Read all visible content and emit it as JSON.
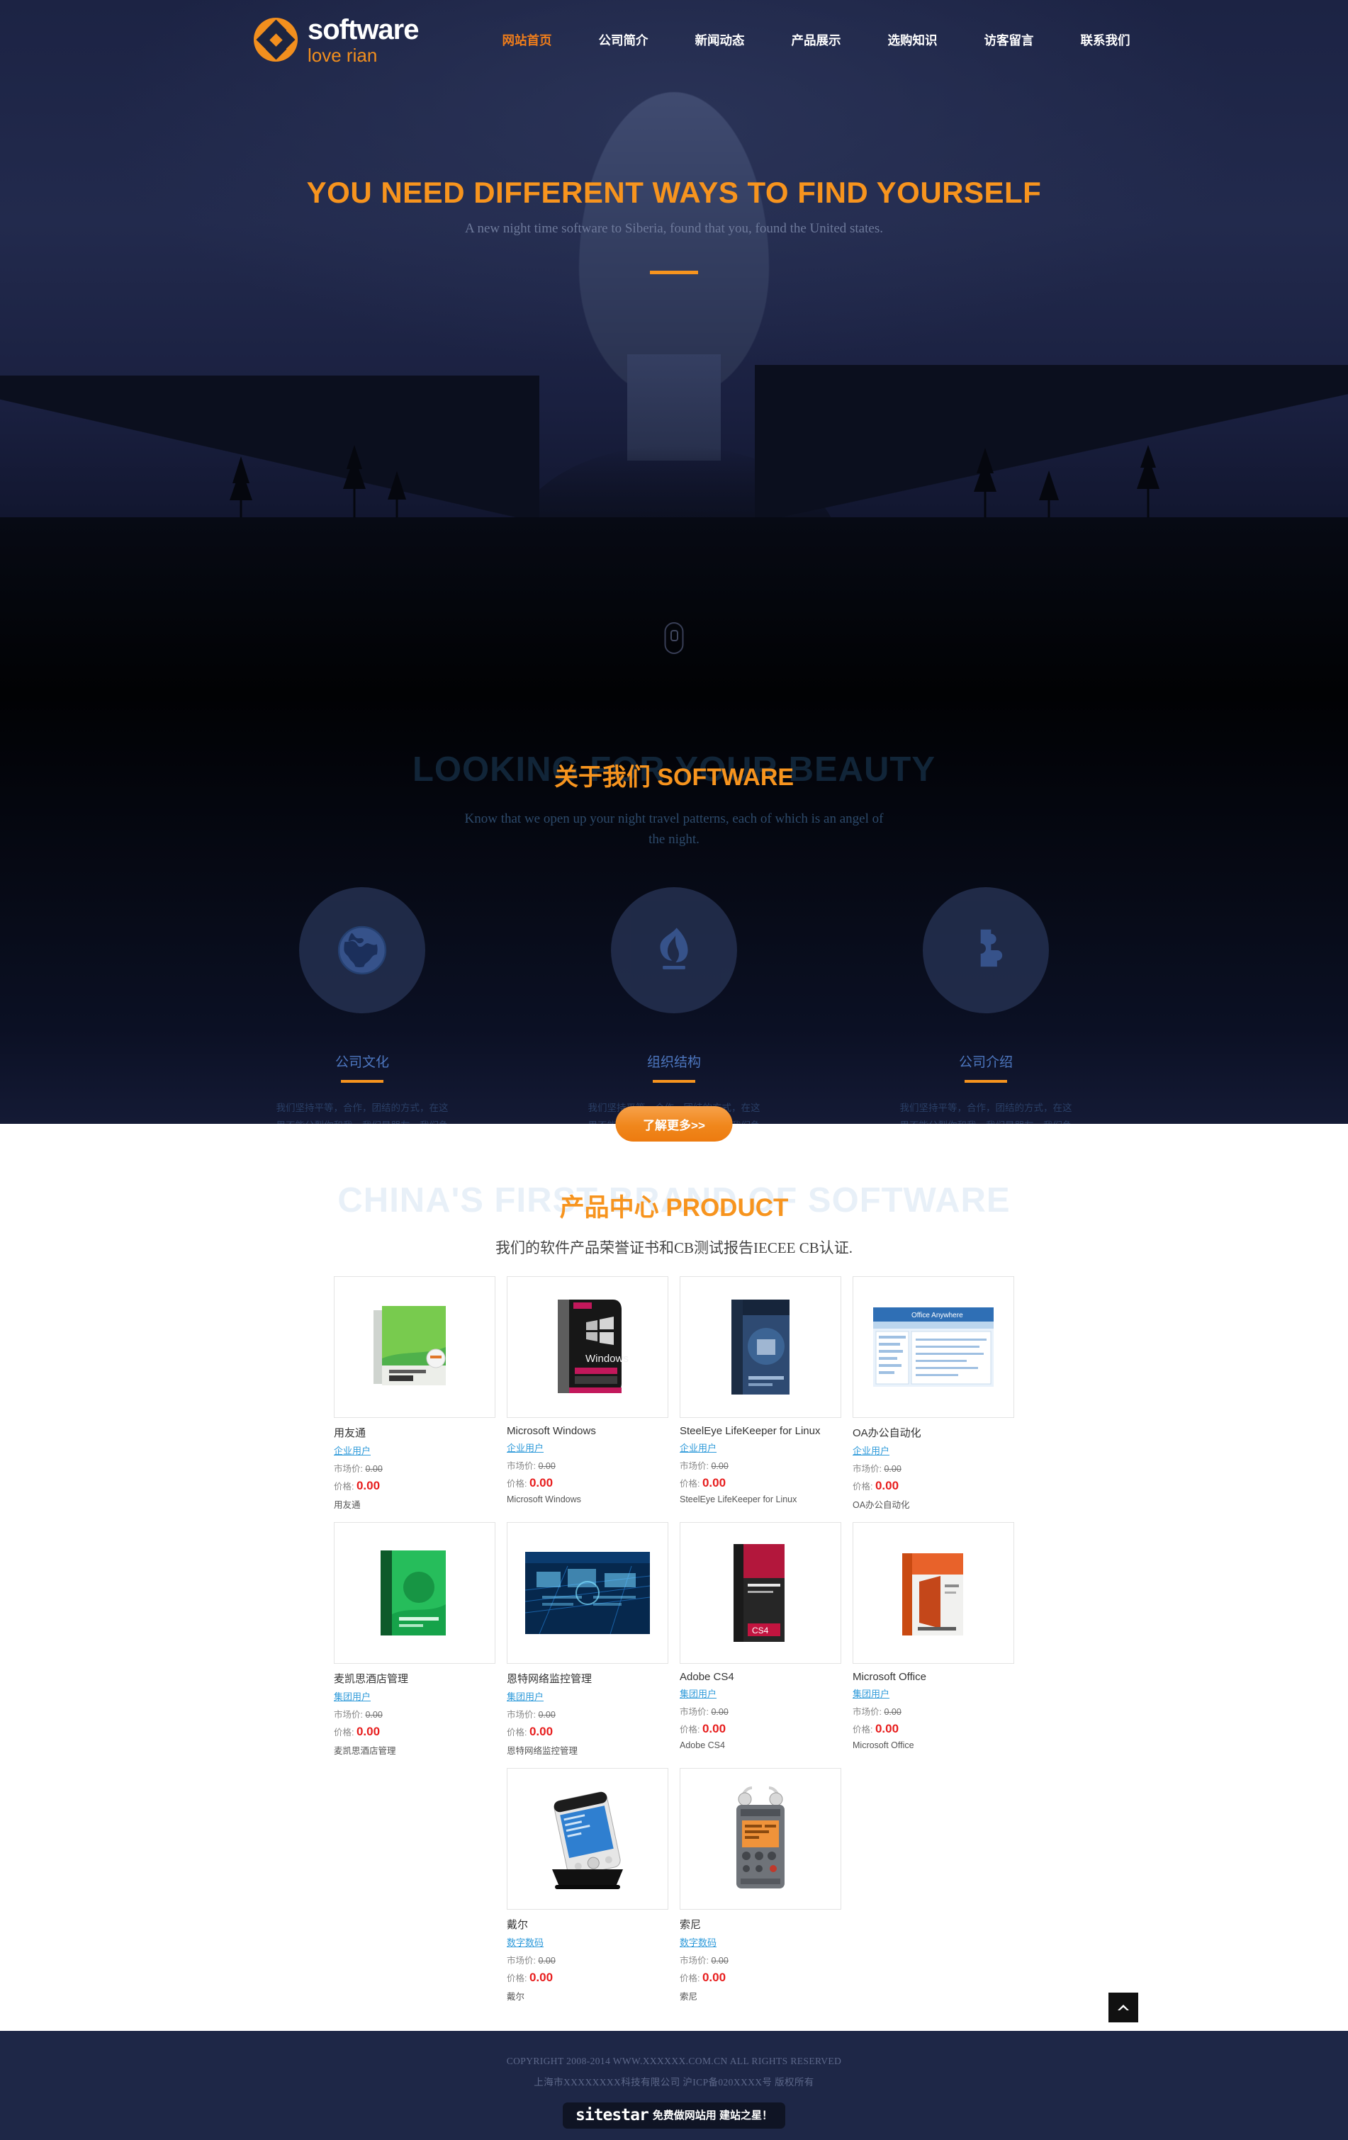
{
  "brand": {
    "title": "software",
    "subtitle": "love rian",
    "logo_icon": "diamond-cross-logo"
  },
  "nav": {
    "items": [
      {
        "label": "网站首页",
        "active": true
      },
      {
        "label": "公司简介",
        "active": false
      },
      {
        "label": "新闻动态",
        "active": false
      },
      {
        "label": "产品展示",
        "active": false
      },
      {
        "label": "选购知识",
        "active": false
      },
      {
        "label": "访客留言",
        "active": false
      },
      {
        "label": "联系我们",
        "active": false
      }
    ]
  },
  "hero": {
    "title": "YOU NEED DIFFERENT WAYS TO FIND YOURSELF",
    "subtitle": "A new night time software to Siberia, found that you, found the United states.",
    "scroll_icon": "mouse-scroll-icon"
  },
  "about": {
    "watermark": "LOOKING FOR YOUR BEAUTY",
    "title": "关于我们 SOFTWARE",
    "description": "Know that we open up your night travel patterns, each of which is an angel of the night.",
    "cards": [
      {
        "icon": "globe-icon",
        "title": "公司文化",
        "text": "我们坚持平等，合作，团结的方式，在这里不能分裂你和我，我们是朋友，我们争取一个共同的目标。"
      },
      {
        "icon": "flame-icon",
        "title": "组织结构",
        "text": "我们坚持平等，合作，团结的方式，在这里不能分裂你和我，我们是朋友，我们争取一个共同的目标。"
      },
      {
        "icon": "puzzle-icon",
        "title": "公司介绍",
        "text": "我们坚持平等，合作，团结的方式，在这里不能分裂你和我，我们是朋友，我们争取一个共同的目标。"
      }
    ],
    "more_button": "了解更多>>"
  },
  "products": {
    "watermark": "CHINA'S FIRST BRAND OF SOFTWARE",
    "title": "产品中心 PRODUCT",
    "subtitle": "我们的软件产品荣誉证书和CB测试报告IECEE CB认证.",
    "market_label": "市场价:",
    "price_label": "价格:",
    "items": [
      {
        "name": "用友通",
        "category": "企业用户",
        "market_price": "0.00",
        "price": "0.00",
        "footer": "用友通",
        "thumb": "box-green-software"
      },
      {
        "name": "Microsoft Windows",
        "category": "企业用户",
        "market_price": "0.00",
        "price": "0.00",
        "footer": "Microsoft Windows",
        "thumb": "box-windows7"
      },
      {
        "name": "SteelEye LifeKeeper for Linux",
        "category": "企业用户",
        "market_price": "0.00",
        "price": "0.00",
        "footer": "SteelEye LifeKeeper for Linux",
        "thumb": "box-blue-software"
      },
      {
        "name": "OA办公自动化",
        "category": "企业用户",
        "market_price": "0.00",
        "price": "0.00",
        "footer": "OA办公自动化",
        "thumb": "screenshot-oa"
      },
      {
        "name": "麦凯思酒店管理",
        "category": "集团用户",
        "market_price": "0.00",
        "price": "0.00",
        "footer": "麦凯思酒店管理",
        "thumb": "box-green-hotel"
      },
      {
        "name": "恩特网络监控管理",
        "category": "集团用户",
        "market_price": "0.00",
        "price": "0.00",
        "footer": "恩特网络监控管理",
        "thumb": "screenshot-network"
      },
      {
        "name": "Adobe CS4",
        "category": "集团用户",
        "market_price": "0.00",
        "price": "0.00",
        "footer": "Adobe CS4",
        "thumb": "box-adobe-cs4"
      },
      {
        "name": "Microsoft Office",
        "category": "集团用户",
        "market_price": "0.00",
        "price": "0.00",
        "footer": "Microsoft Office",
        "thumb": "box-ms-office"
      },
      {
        "name": "戴尔",
        "category": "数字数码",
        "market_price": "0.00",
        "price": "0.00",
        "footer": "戴尔",
        "thumb": "device-pda-dell"
      },
      {
        "name": "索尼",
        "category": "数字数码",
        "market_price": "0.00",
        "price": "0.00",
        "footer": "索尼",
        "thumb": "device-recorder-sony"
      }
    ],
    "scroll_top_icon": "chevron-up-icon"
  },
  "footer": {
    "copyright": "COPYRIGHT 2008-2014 WWW.XXXXXX.COM.CN ALL RIGHTS RESERVED",
    "company": "上海市XXXXXXXX科技有限公司   沪ICP备020XXXX号  版权所有",
    "sitestar_logo": "sitestar",
    "sitestar_text": "免费做网站用 建站之星！"
  },
  "colors": {
    "accent": "#f7941e",
    "nav_bg": "#1d2540",
    "price_red": "#e71d1d",
    "link_blue": "#2e9ada",
    "footer_bg": "#1e2747"
  }
}
